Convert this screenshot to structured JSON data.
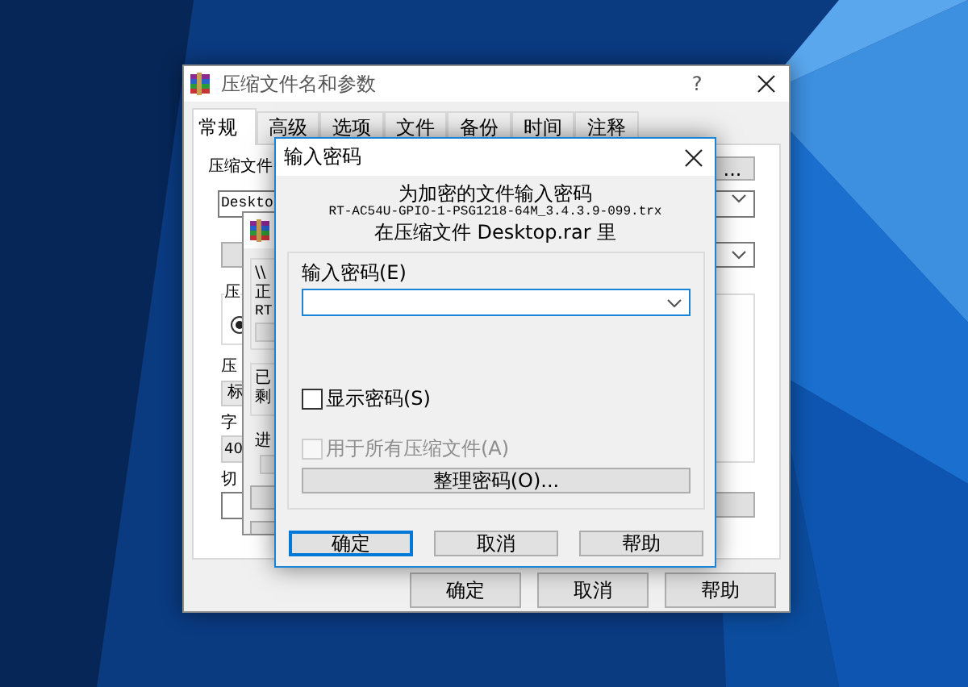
{
  "archive_window": {
    "title": "压缩文件名和参数",
    "help_button": "?",
    "tabs": [
      {
        "label": "常规",
        "selected": true
      },
      {
        "label": "高级",
        "selected": false
      },
      {
        "label": "选项",
        "selected": false
      },
      {
        "label": "文件",
        "selected": false
      },
      {
        "label": "备份",
        "selected": false
      },
      {
        "label": "时间",
        "selected": false
      },
      {
        "label": "注释",
        "selected": false
      }
    ],
    "archive_name_label": "压缩文件",
    "archive_name_value": "Deskto",
    "browse_button": "...",
    "group_title": "压",
    "mode_radio": {
      "checked": true
    },
    "format_label": "压",
    "method_value": "标",
    "dict_label": "字",
    "dict_value": "40",
    "split_label": "切",
    "buttons": [
      "确定",
      "取消",
      "帮助"
    ]
  },
  "progress_window": {
    "path_lines": [
      "\\\\",
      "正",
      "RT"
    ],
    "stat_lines": [
      "已",
      "剩"
    ],
    "progress_label": "进"
  },
  "password_dialog": {
    "title": "输入密码",
    "message": [
      "为加密的文件输入密码",
      "RT-AC54U-GPIO-1-PSG1218-64M_3.4.3.9-099.trx",
      "在压缩文件 Desktop.rar 里"
    ],
    "password_label": "输入密码(E)",
    "show_password": {
      "label": "显示密码(S)",
      "checked": false
    },
    "all_archives": {
      "label": "用于所有压缩文件(A)",
      "checked": false,
      "disabled": true
    },
    "organize_button": "整理密码(O)...",
    "buttons": [
      {
        "label": "确定",
        "default": true
      },
      {
        "label": "取消",
        "default": false
      },
      {
        "label": "帮助",
        "default": false
      }
    ]
  }
}
